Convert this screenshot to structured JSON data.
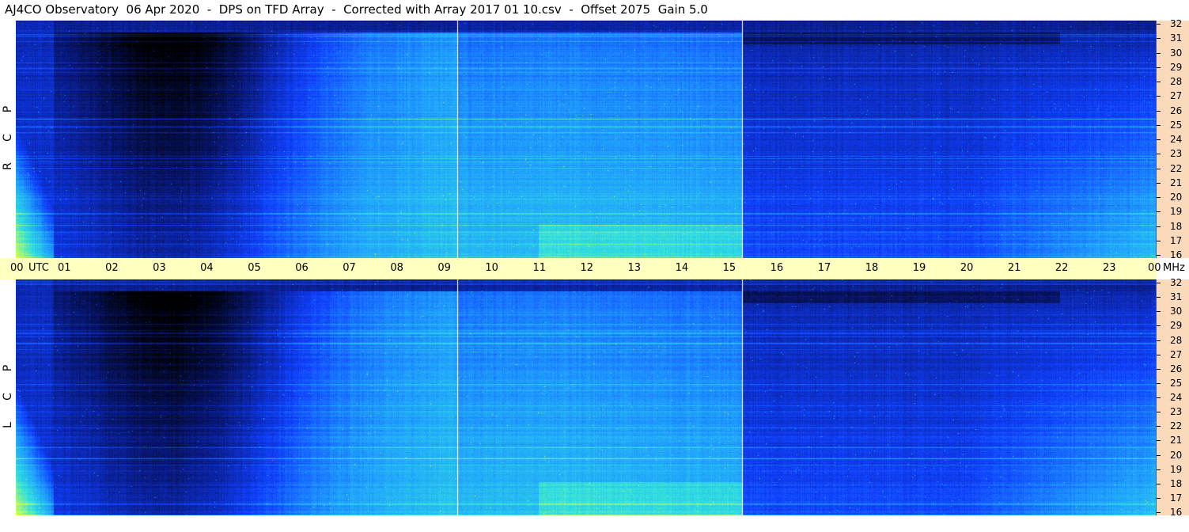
{
  "title": "AJ4CO Observatory  06 Apr 2020  -  DPS on TFD Array  -  Corrected with Array 2017 01 10.csv  -  Offset 2075  Gain 5.0",
  "panels": [
    {
      "id": "rcp",
      "letters": [
        "R",
        "C",
        "P"
      ]
    },
    {
      "id": "lcp",
      "letters": [
        "L",
        "C",
        "P"
      ]
    }
  ],
  "frequency_axis": {
    "unit": "MHz",
    "ticks": [
      "32",
      "31",
      "30",
      "29",
      "28",
      "27",
      "26",
      "25",
      "24",
      "23",
      "22",
      "21",
      "20",
      "19",
      "18",
      "17",
      "16"
    ]
  },
  "time_axis": {
    "unit": "UTC",
    "ticks": [
      "00",
      "01",
      "02",
      "03",
      "04",
      "05",
      "06",
      "07",
      "08",
      "09",
      "10",
      "11",
      "12",
      "13",
      "14",
      "15",
      "16",
      "17",
      "18",
      "19",
      "20",
      "21",
      "22",
      "23",
      "00"
    ]
  },
  "chart_data": [
    {
      "type": "heatmap",
      "title": "AJ4CO Observatory  06 Apr 2020  -  DPS on TFD Array  -  Corrected with Array 2017 01 10.csv  -  Offset 2075  Gain 5.0",
      "panel": "RCP",
      "x_range_utc_hours": [
        0,
        24
      ],
      "y_range_mhz": [
        16,
        32
      ],
      "xlabel": "UTC",
      "ylabel": "MHz",
      "colormap": [
        "#000000",
        "#0a1a80",
        "#1040ff",
        "#20a0ff",
        "#30e0e0",
        "#c0ff60",
        "#ffff00",
        "#ff4060"
      ],
      "time_markers_utc_hours": [
        9.3,
        15.3
      ]
    },
    {
      "type": "heatmap",
      "panel": "LCP",
      "x_range_utc_hours": [
        0,
        24
      ],
      "y_range_mhz": [
        16,
        32
      ],
      "xlabel": "UTC",
      "ylabel": "MHz",
      "colormap": [
        "#000000",
        "#0a1a80",
        "#1040ff",
        "#20a0ff",
        "#30e0e0",
        "#c0ff60",
        "#ffff00",
        "#ff4060"
      ],
      "time_markers_utc_hours": [
        9.3,
        15.3
      ]
    }
  ]
}
